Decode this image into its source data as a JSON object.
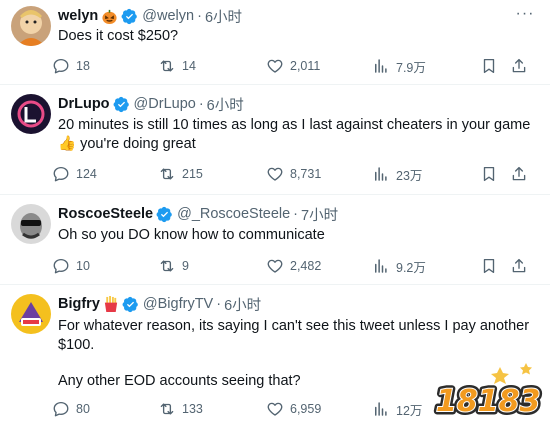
{
  "tweets": [
    {
      "name": "welyn",
      "badge": "pumpkin-emoji",
      "handle": "@welyn",
      "time": "6小时",
      "text_lines": [
        "Does it cost $250?"
      ],
      "replies": "18",
      "retweets": "14",
      "likes": "2,011",
      "views": "7.9万"
    },
    {
      "name": "DrLupo",
      "badge": "",
      "handle": "@DrLupo",
      "time": "6小时",
      "text_lines": [
        "20 minutes is still 10 times as long as I last against cheaters in your game",
        "you're doing great"
      ],
      "thumbs_up": "👍",
      "replies": "124",
      "retweets": "215",
      "likes": "8,731",
      "views": "23万"
    },
    {
      "name": "RoscoeSteele",
      "badge": "",
      "handle": "@_RoscoeSteele",
      "time": "7小时",
      "text_lines": [
        "Oh so you DO know how to communicate"
      ],
      "replies": "10",
      "retweets": "9",
      "likes": "2,482",
      "views": "9.2万"
    },
    {
      "name": "Bigfry",
      "badge": "fries-emoji",
      "handle": "@BigfryTV",
      "time": "6小时",
      "text_lines": [
        "For whatever reason, its saying I can't see this tweet unless I pay another",
        "$100.",
        "",
        "Any other EOD accounts seeing that?"
      ],
      "replies": "80",
      "retweets": "133",
      "likes": "6,959",
      "views": "12万"
    }
  ],
  "separator": "·",
  "watermark": {
    "text": "18183"
  },
  "colors": {
    "verified": "#1d9bf0",
    "muted": "#536471",
    "text": "#0f1419",
    "divider": "#eff3f4"
  }
}
